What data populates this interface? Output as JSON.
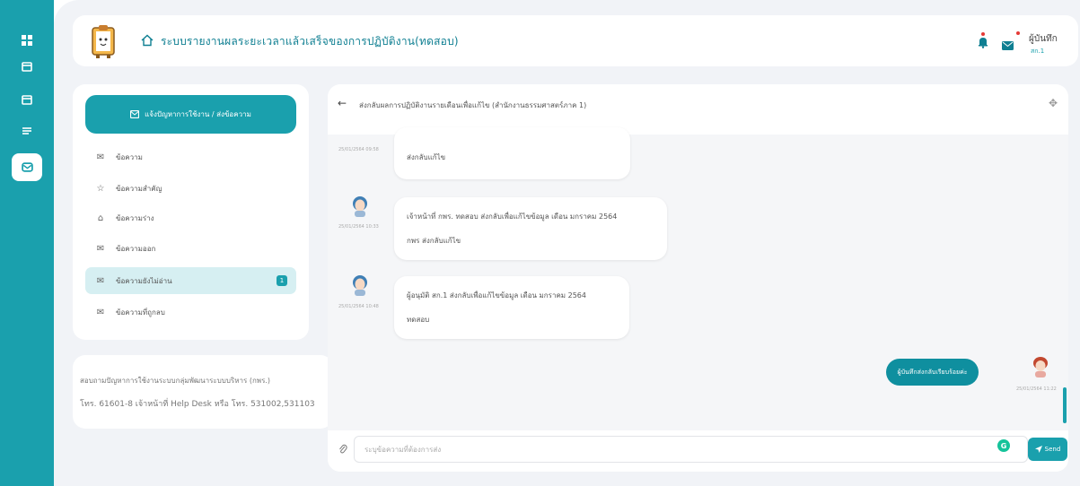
{
  "rail": {
    "icons": [
      "dashboard-icon",
      "calendar-icon",
      "calendar-check-icon",
      "list-icon",
      "mail-icon"
    ],
    "active": "mail-icon"
  },
  "header": {
    "title": "ระบบรายงานผลระยะเวลาแล้วเสร็จของการปฏิบัติงาน(ทดสอบ)",
    "user_name": "ผู้บันทึก",
    "user_role": "สก.1"
  },
  "sidebar": {
    "compose_label": "แจ้งปัญหาการใช้งาน / ส่งข้อความ",
    "items": [
      {
        "label": "ข้อความ",
        "icon": "inbox-icon"
      },
      {
        "label": "ข้อความสำคัญ",
        "icon": "star-icon"
      },
      {
        "label": "ข้อความร่าง",
        "icon": "draft-icon"
      },
      {
        "label": "ข้อความออก",
        "icon": "outbox-icon"
      },
      {
        "label": "ข้อความยังไม่อ่าน",
        "icon": "unread-icon",
        "badge": "1"
      },
      {
        "label": "ข้อความที่ถูกลบ",
        "icon": "trash-icon"
      }
    ],
    "active_index": 4
  },
  "info": {
    "line1": "สอบถามปัญหาการใช้งานระบบกลุ่มพัฒนาระบบบริหาร (กพร.)",
    "line2": "โทร. 61601-8 เจ้าหน้าที่ Help Desk หรือ โทร. 531002,531103"
  },
  "chat": {
    "title": "ส่งกลับผลการปฏิบัติงานรายเดือนเพื่อแก้ไข (สำนักงานธรรมศาสตร์ภาค 1)",
    "messages": [
      {
        "time": "25/01/2564 09:58",
        "lines": [
          "ส่งกลับแก้ไข"
        ]
      },
      {
        "time": "25/01/2564 10:33",
        "lines": [
          "เจ้าหน้าที่ กพร. ทดสอบ ส่งกลับเพื่อแก้ไขข้อมูล เดือน มกราคม 2564",
          "กพร ส่งกลับแก้ไข"
        ]
      },
      {
        "time": "25/01/2564 10:48",
        "lines": [
          "ผู้อนุมัติ สก.1 ส่งกลับเพื่อแก้ไขข้อมูล เดือน มกราคม 2564",
          "ทดสอบ"
        ]
      }
    ],
    "mine": {
      "text": "ผู้บันทึกส่งกลับเรียบร้อยค่ะ",
      "time": "25/01/2564 11:22"
    },
    "input_placeholder": "ระบุข้อความที่ต้องการส่ง",
    "send_label": "Send"
  }
}
